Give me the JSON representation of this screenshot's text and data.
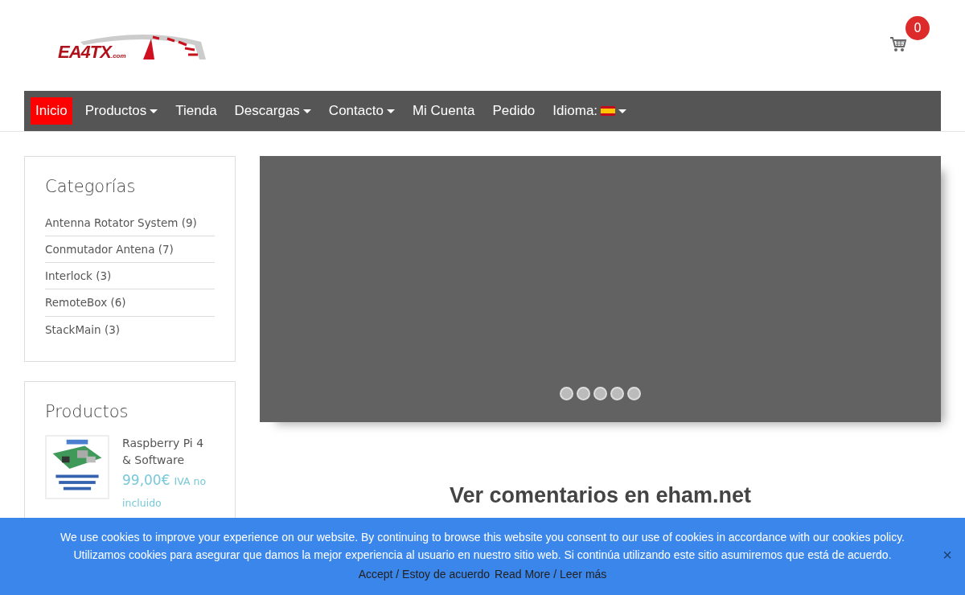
{
  "logo": {
    "main": "EA4TX",
    ".com": ".com"
  },
  "cart": {
    "count": "0"
  },
  "nav": [
    {
      "label": "Inicio",
      "selected": true,
      "dropdown": false
    },
    {
      "label": "Productos",
      "selected": false,
      "dropdown": true
    },
    {
      "label": "Tienda",
      "selected": false,
      "dropdown": false
    },
    {
      "label": "Descargas",
      "selected": false,
      "dropdown": true
    },
    {
      "label": "Contacto",
      "selected": false,
      "dropdown": true
    },
    {
      "label": "Mi Cuenta",
      "selected": false,
      "dropdown": false
    },
    {
      "label": "Pedido",
      "selected": false,
      "dropdown": false
    },
    {
      "label": "Idioma:",
      "selected": false,
      "dropdown": true,
      "flag": true
    }
  ],
  "categories": {
    "title": "Categorías",
    "items": [
      "Antenna Rotator System (9)",
      "Conmutador Antena (7)",
      "Interlock (3)",
      "RemoteBox (6)",
      "StackMain (3)"
    ]
  },
  "products": {
    "title": "Productos",
    "items": [
      {
        "name": "Raspberry Pi 4 & Software",
        "price": "99,00€",
        "tax": "IVA no incluido"
      }
    ]
  },
  "slider": {
    "dots": [
      {
        "selected": false
      },
      {
        "selected": false
      },
      {
        "selected": false
      },
      {
        "selected": false
      },
      {
        "selected": false
      }
    ]
  },
  "heading": "Ver comentarios en eham.net",
  "cookie": {
    "lines": [
      "We use cookies to improve your experience on our website. By continuing to browse this website you consent to our use of cookies in accordance with our cookies policy.",
      "Utilizamos cookies para asegurar que damos la mejor experiencia al usuario en nuestro sitio web. Si continúa utilizando este sitio asumiremos que está de acuerdo."
    ],
    "accept": "Accept / Estoy de acuerdo",
    "more": "Read More / Leer más",
    "close": "×"
  }
}
